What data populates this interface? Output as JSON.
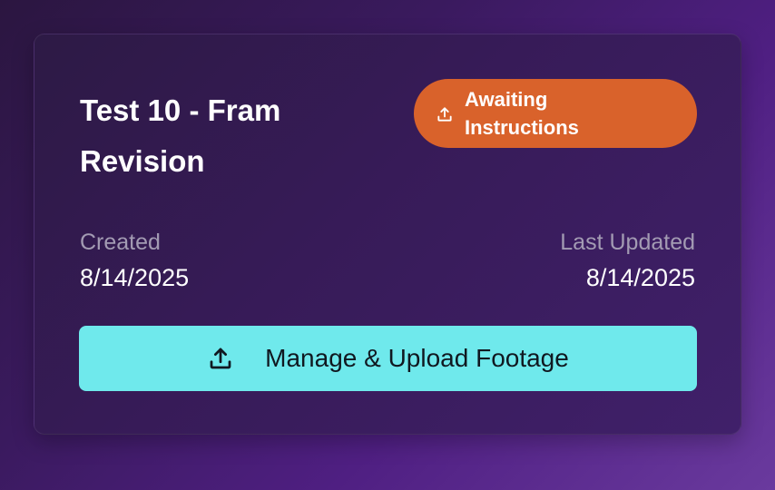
{
  "card": {
    "title": "Test 10 - Fram Revision",
    "status": {
      "label": "Awaiting Instructions",
      "icon": "upload-icon",
      "color": "#d9622b"
    },
    "created": {
      "label": "Created",
      "value": "8/14/2025"
    },
    "last_updated": {
      "label": "Last Updated",
      "value": "8/14/2025"
    },
    "action": {
      "label": "Manage & Upload Footage",
      "icon": "upload-icon",
      "color": "#6fe9ec"
    }
  }
}
